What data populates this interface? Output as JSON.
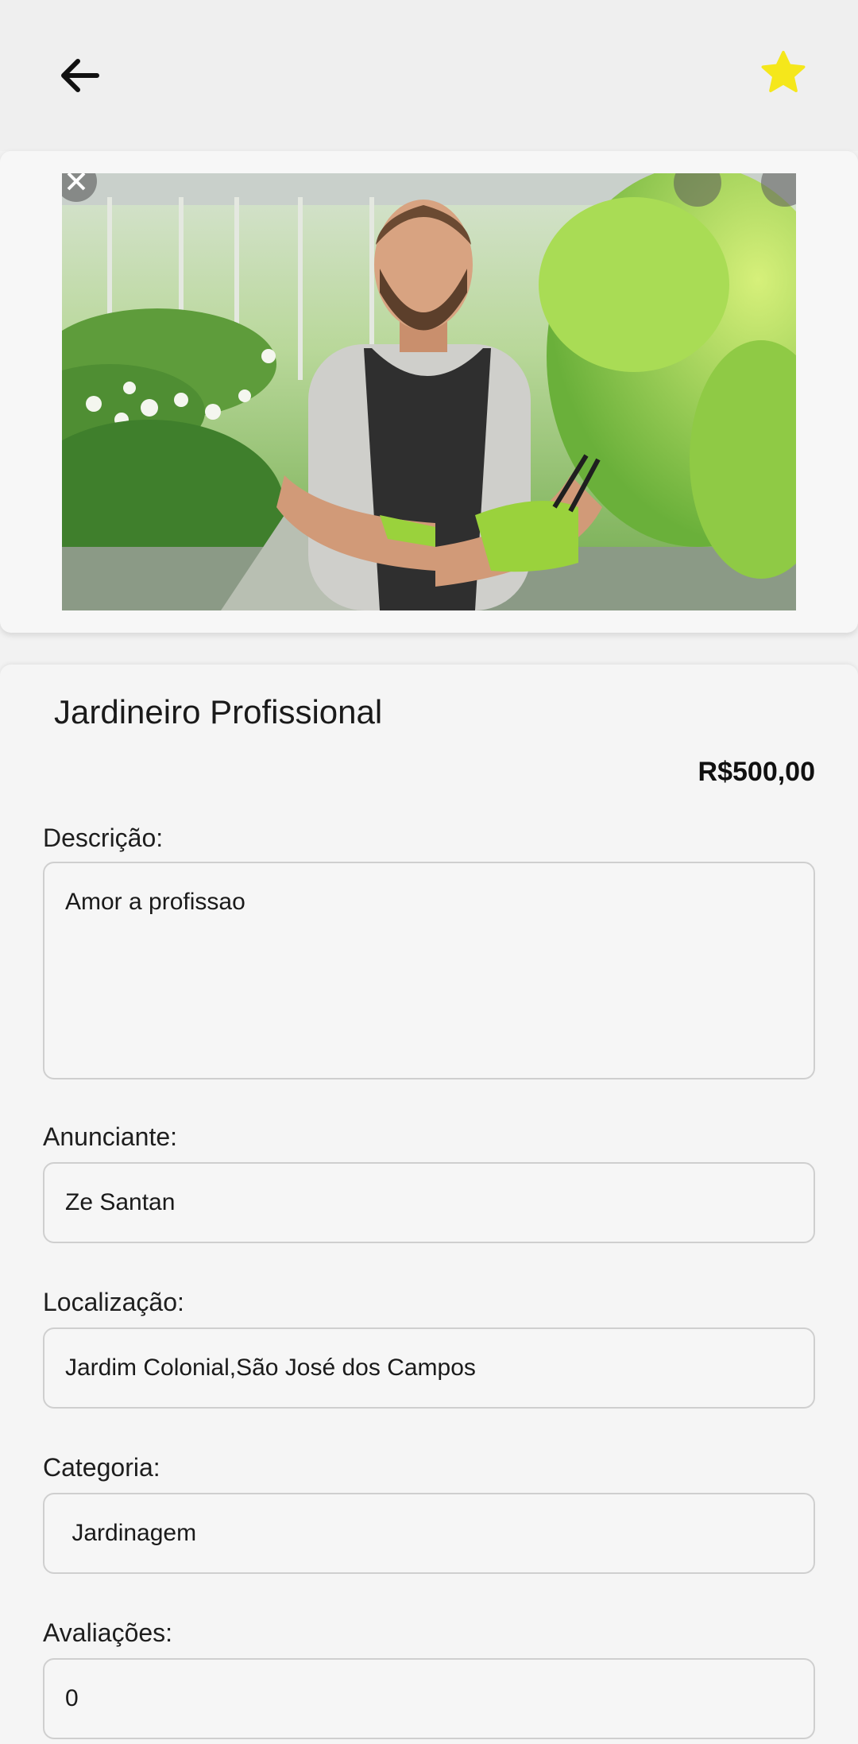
{
  "header": {
    "back_icon": "arrow-left-icon",
    "favorite_icon": "star-icon",
    "favorite_color": "#f5e71b"
  },
  "listing": {
    "title": "Jardineiro Profissional",
    "price": "R$500,00",
    "image_description_icon": "photo"
  },
  "fields": {
    "descricao": {
      "label": "Descrição:",
      "value": "Amor a profissao"
    },
    "anunciante": {
      "label": "Anunciante:",
      "value": "Ze Santan"
    },
    "localizacao": {
      "label": "Localização:",
      "value": "Jardim Colonial,São José dos Campos"
    },
    "categoria": {
      "label": "Categoria:",
      "value": " Jardinagem"
    },
    "avaliacoes": {
      "label": "Avaliações:",
      "value": "0"
    }
  }
}
